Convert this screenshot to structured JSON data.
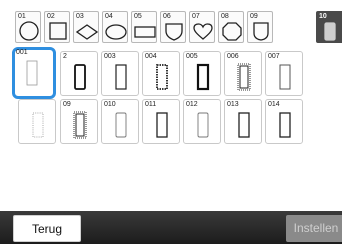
{
  "shape_tabs": [
    {
      "number": "01",
      "shape": "circle-icon"
    },
    {
      "number": "02",
      "shape": "square-icon"
    },
    {
      "number": "03",
      "shape": "diamond-icon"
    },
    {
      "number": "04",
      "shape": "oval-icon"
    },
    {
      "number": "05",
      "shape": "rectangle-icon"
    },
    {
      "number": "06",
      "shape": "shield-icon"
    },
    {
      "number": "07",
      "shape": "heart-icon"
    },
    {
      "number": "08",
      "shape": "octagon-icon"
    },
    {
      "number": "09",
      "shape": "shield-round-icon"
    },
    {
      "number": "10",
      "shape": "rounded-rect-icon",
      "selected": true
    }
  ],
  "frames": [
    {
      "number": "001",
      "style": "thin-solid",
      "selected": true
    },
    {
      "number": "002",
      "style": "thick-solid"
    },
    {
      "number": "003",
      "style": "solid"
    },
    {
      "number": "004",
      "style": "dashed-thick"
    },
    {
      "number": "005",
      "style": "double"
    },
    {
      "number": "006",
      "style": "dotted-double"
    },
    {
      "number": "007",
      "style": "thin-light"
    },
    {
      "number": "008",
      "style": "dotted-light"
    },
    {
      "number": "009",
      "style": "dotted-double"
    },
    {
      "number": "010",
      "style": "thin-rounded"
    },
    {
      "number": "011",
      "style": "solid"
    },
    {
      "number": "012",
      "style": "thin-rounded"
    },
    {
      "number": "013",
      "style": "solid"
    },
    {
      "number": "014",
      "style": "solid"
    }
  ],
  "frame_labels_visible": {
    "001": "001",
    "002": "2",
    "003": "003",
    "004": "004",
    "005": "005",
    "006": "006",
    "007": "007",
    "008": "",
    "009": "09",
    "010": "010",
    "011": "011",
    "012": "012",
    "013": "013",
    "014": "014"
  },
  "buttons": {
    "back_label": "Terug",
    "settings_label": "Instellen"
  },
  "colors": {
    "selection": "#2f8fe0",
    "bottom_bar": "#2a2a2a",
    "selected_tab": "#4a4a4a"
  }
}
